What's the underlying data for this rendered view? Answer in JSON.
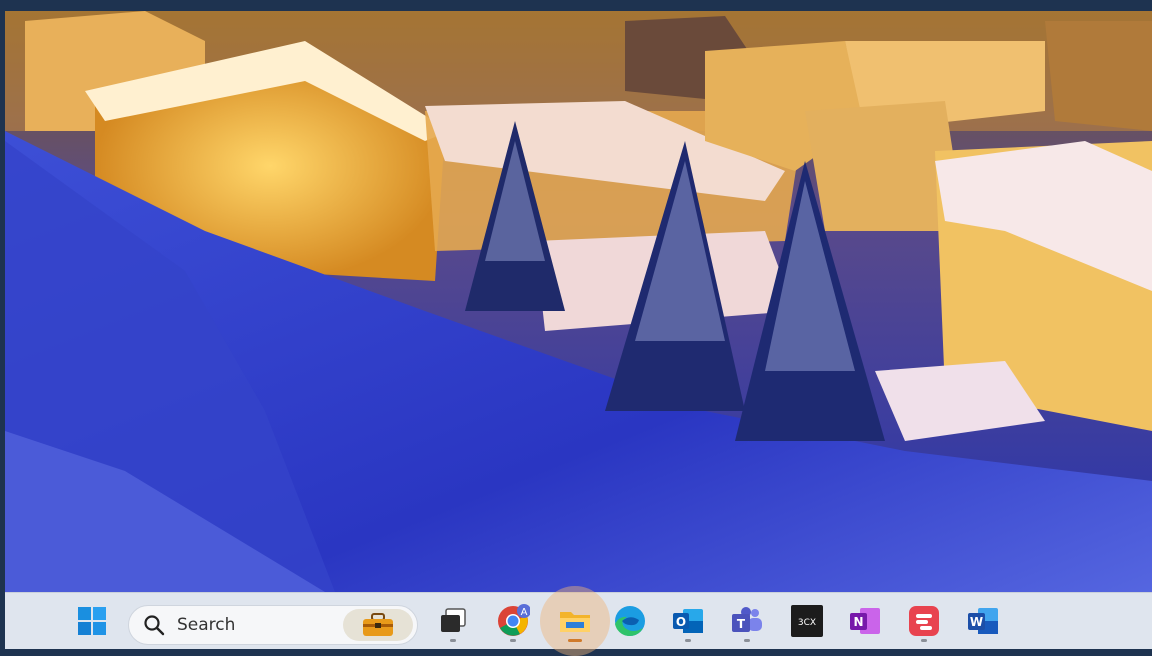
{
  "desktop": {
    "wallpaper": "snowy-village-at-dusk",
    "accent_color": "#1e3350"
  },
  "taskbar": {
    "search": {
      "placeholder": "Search"
    },
    "apps": [
      {
        "name": "start",
        "icon": "windows-logo-icon"
      },
      {
        "name": "widgets",
        "icon": "briefcase-icon"
      },
      {
        "name": "task-view",
        "icon": "task-view-icon"
      },
      {
        "name": "chrome",
        "icon": "chrome-icon",
        "badge": "A"
      },
      {
        "name": "file-explorer",
        "icon": "folder-icon",
        "active": true
      },
      {
        "name": "edge",
        "icon": "edge-icon"
      },
      {
        "name": "outlook",
        "icon": "outlook-icon",
        "letter": "O"
      },
      {
        "name": "teams",
        "icon": "teams-icon",
        "letter": "T"
      },
      {
        "name": "3cx",
        "icon": "3cx-icon",
        "letter": "3CX"
      },
      {
        "name": "onenote",
        "icon": "onenote-icon",
        "letter": "N"
      },
      {
        "name": "app-red",
        "icon": "red-app-icon"
      },
      {
        "name": "word",
        "icon": "word-icon",
        "letter": "W"
      }
    ]
  }
}
